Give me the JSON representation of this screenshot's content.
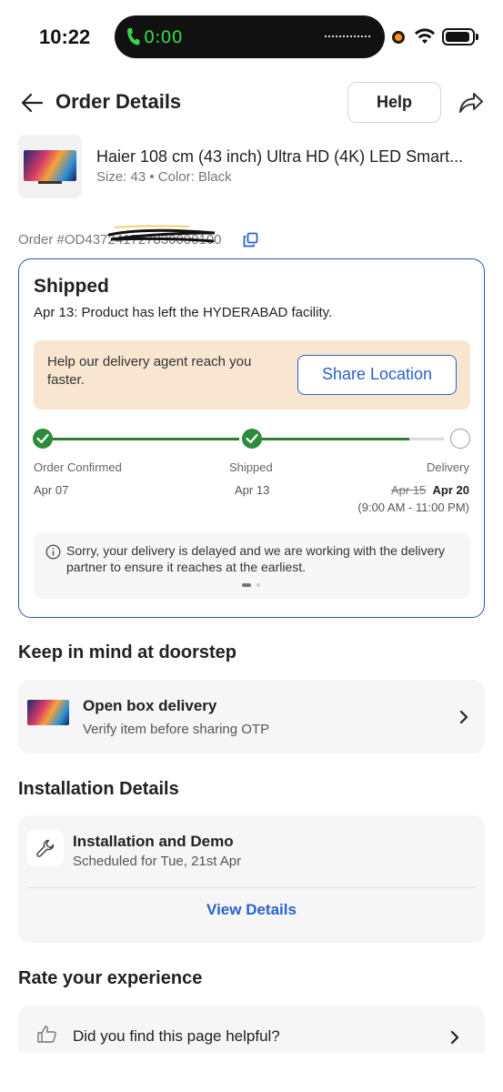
{
  "status_bar": {
    "time": "10:22",
    "call_timer": "0:00"
  },
  "header": {
    "title": "Order Details",
    "help_label": "Help"
  },
  "product": {
    "title": "Haier 108 cm (43 inch) Ultra HD (4K) LED Smart...",
    "subtitle": "Size: 43 • Color: Black"
  },
  "order": {
    "id_text": "Order #OD437241727830000100"
  },
  "shipment": {
    "status": "Shipped",
    "message": "Apr 13: Product has left the HYDERABAD facility.",
    "agent_prompt": "Help our delivery agent reach you faster.",
    "share_location_label": "Share Location",
    "steps": [
      {
        "label": "Order Confirmed",
        "date": "Apr 07",
        "done": true
      },
      {
        "label": "Shipped",
        "date": "Apr 13",
        "done": true
      },
      {
        "label": "Delivery",
        "old_date": "Apr 15",
        "date": "Apr 20",
        "slot": "(9:00 AM - 11:00 PM)",
        "done": false
      }
    ],
    "progress_to_delivery": 0.8,
    "delay_notice": "Sorry, your delivery is delayed and we are working with the delivery partner to ensure it reaches at the earliest.",
    "accent_color": "#2a55b0",
    "done_color": "#2e7d32"
  },
  "doorstep": {
    "section_title": "Keep in mind at doorstep",
    "title": "Open box delivery",
    "subtitle": "Verify item before sharing OTP"
  },
  "installation": {
    "section_title": "Installation Details",
    "title": "Installation and Demo",
    "subtitle": "Scheduled for Tue, 21st Apr",
    "view_details_label": "View Details"
  },
  "rating": {
    "section_title": "Rate your experience",
    "question": "Did you find this page helpful?"
  }
}
